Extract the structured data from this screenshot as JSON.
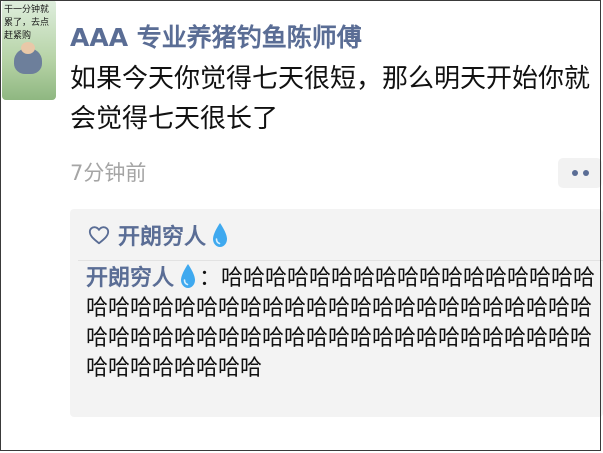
{
  "post": {
    "avatar_text": "干一分钟就累了，去点赶紧购",
    "username": "AAA 专业养猪钓鱼陈师傅",
    "content": "如果今天你觉得七天很短，那么明天开始你就会觉得七天很长了",
    "time": "7分钟前"
  },
  "likes": {
    "name": "开朗穷人",
    "icon": "heart-outline-icon",
    "emoji": "droplet-icon"
  },
  "comment": {
    "author": "开朗穷人",
    "separator": "：",
    "text": "哈哈哈哈哈哈哈哈哈哈哈哈哈哈哈哈哈哈哈哈哈哈哈哈哈哈哈哈哈哈哈哈哈哈哈哈哈哈哈哈哈哈哈哈哈哈哈哈哈哈哈哈哈哈哈哈哈哈哈哈哈哈哈哈哈哈哈哈哈哈哈"
  },
  "colors": {
    "name_blue": "#5a6d95",
    "time_gray": "#a5a5a5",
    "panel_bg": "#f3f3f3",
    "drop_blue": "#3fa9ef"
  }
}
